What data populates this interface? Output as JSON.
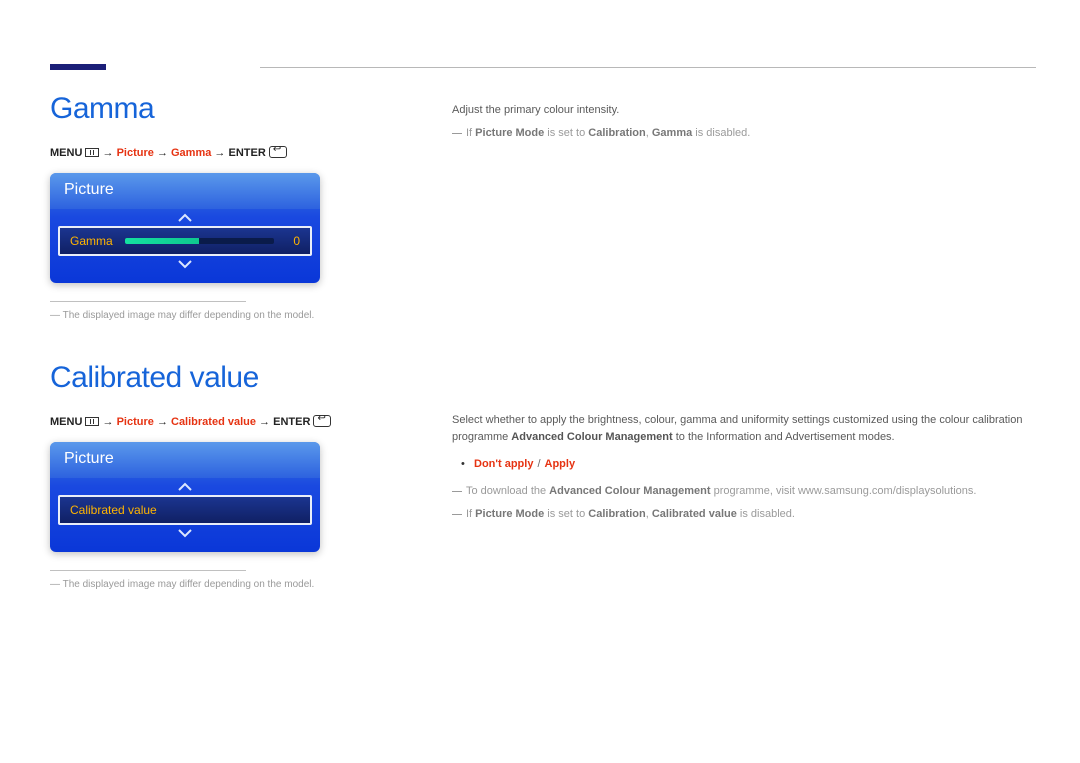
{
  "sections": {
    "gamma": {
      "title": "Gamma",
      "menu_path": {
        "menu": "MENU",
        "arrow": "→",
        "category": "Picture",
        "item": "Gamma",
        "enter": "ENTER"
      },
      "osd": {
        "panel_title": "Picture",
        "row_label": "Gamma",
        "row_value": "0"
      },
      "disclaimer": "The displayed image may differ depending on the model.",
      "right": {
        "intro": "Adjust the primary colour intensity.",
        "note_prefix": "If ",
        "picture_mode": "Picture Mode",
        "note_mid": " is set to ",
        "calibration": "Calibration",
        "note_sep": ", ",
        "gamma": "Gamma",
        "note_end": " is disabled."
      }
    },
    "calibrated": {
      "title": "Calibrated value",
      "menu_path": {
        "menu": "MENU",
        "arrow": "→",
        "category": "Picture",
        "item": "Calibrated value",
        "enter": "ENTER"
      },
      "osd": {
        "panel_title": "Picture",
        "row_label": "Calibrated value"
      },
      "disclaimer": "The displayed image may differ depending on the model.",
      "right": {
        "para1a": "Select whether to apply the brightness, colour, gamma and uniformity settings customized using the colour calibration programme ",
        "acm": "Advanced Colour Management",
        "para1b": " to the Information and Advertisement modes.",
        "opt_dont": "Don't apply",
        "opt_apply": "Apply",
        "dl_prefix": "To download the ",
        "dl_mid": " programme, visit www.samsung.com/displaysolutions.",
        "note2_prefix": "If ",
        "picture_mode": "Picture Mode",
        "note2_mid": " is set to ",
        "calibration": "Calibration",
        "note2_sep": ", ",
        "cv": "Calibrated value",
        "note2_end": " is disabled."
      }
    }
  }
}
